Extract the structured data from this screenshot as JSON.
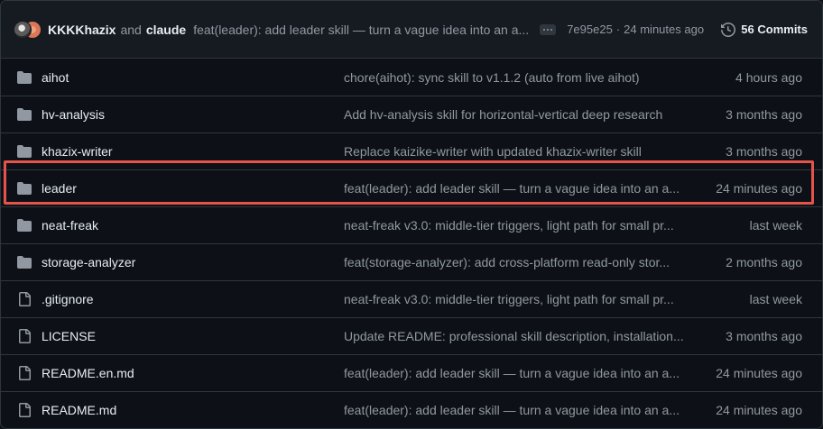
{
  "header": {
    "author_1": "KKKKhazix",
    "and_text": "and",
    "author_2": "claude",
    "commit_message": "feat(leader): add leader skill — turn a vague idea into an a...",
    "commit_sha": "7e95e25",
    "separator": "·",
    "commit_time": "24 minutes ago",
    "commits_count": "56 Commits"
  },
  "files": [
    {
      "name": "aihot",
      "type": "folder",
      "message": "chore(aihot): sync skill to v1.1.2 (auto from live aihot)",
      "time": "4 hours ago"
    },
    {
      "name": "hv-analysis",
      "type": "folder",
      "message": "Add hv-analysis skill for horizontal-vertical deep research",
      "time": "3 months ago"
    },
    {
      "name": "khazix-writer",
      "type": "folder",
      "message": "Replace kaizike-writer with updated khazix-writer skill",
      "time": "3 months ago"
    },
    {
      "name": "leader",
      "type": "folder",
      "message": "feat(leader): add leader skill — turn a vague idea into an a...",
      "time": "24 minutes ago"
    },
    {
      "name": "neat-freak",
      "type": "folder",
      "message": "neat-freak v3.0: middle-tier triggers, light path for small pr...",
      "time": "last week"
    },
    {
      "name": "storage-analyzer",
      "type": "folder",
      "message": "feat(storage-analyzer): add cross-platform read-only stor...",
      "time": "2 months ago"
    },
    {
      "name": ".gitignore",
      "type": "file",
      "message": "neat-freak v3.0: middle-tier triggers, light path for small pr...",
      "time": "last week"
    },
    {
      "name": "LICENSE",
      "type": "file",
      "message": "Update README: professional skill description, installation...",
      "time": "3 months ago"
    },
    {
      "name": "README.en.md",
      "type": "file",
      "message": "feat(leader): add leader skill — turn a vague idea into an a...",
      "time": "24 minutes ago"
    },
    {
      "name": "README.md",
      "type": "file",
      "message": "feat(leader): add leader skill — turn a vague idea into an a...",
      "time": "24 minutes ago"
    }
  ],
  "highlight_color": "#e5534b",
  "icons": {
    "folder": "folder-icon",
    "file": "file-icon",
    "history": "history-icon",
    "ellipsis": "ellipsis-icon"
  }
}
